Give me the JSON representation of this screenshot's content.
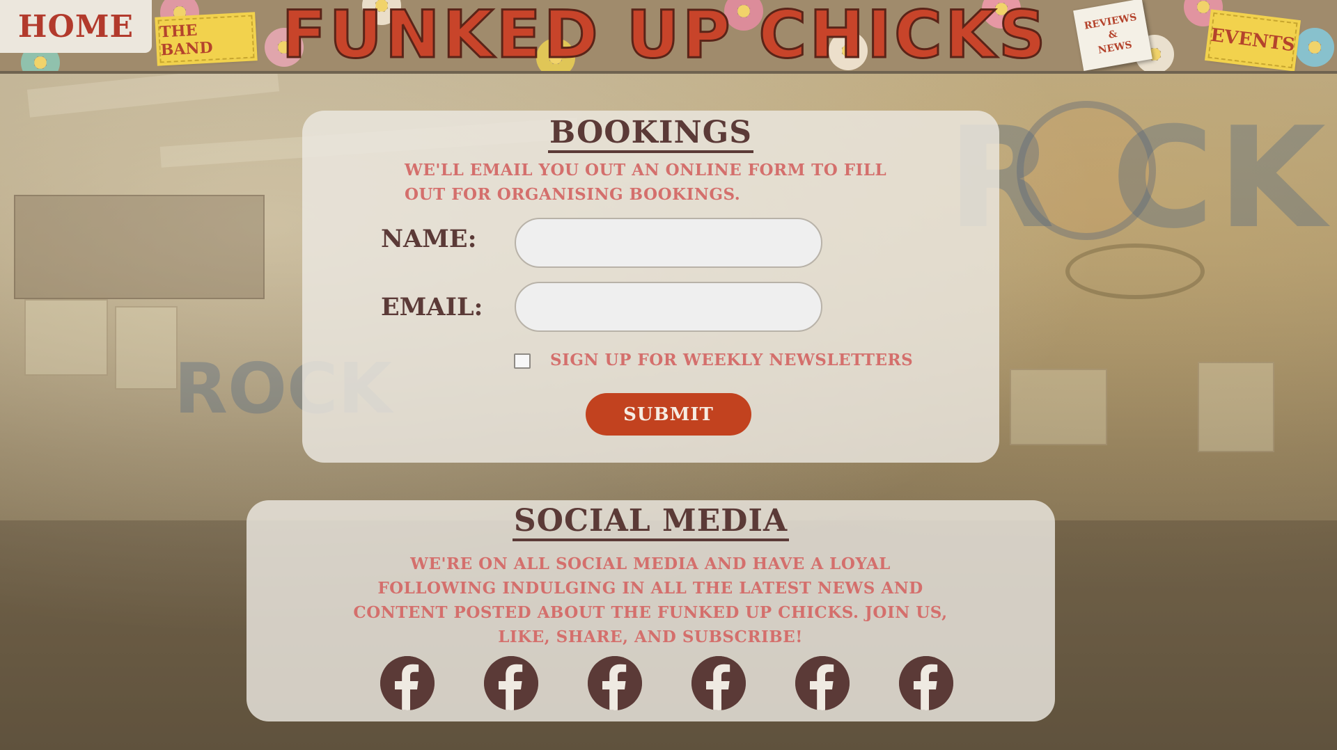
{
  "header": {
    "home_label": "Home",
    "band_label": "The Band",
    "site_title": "Funked Up Chicks",
    "news_label": [
      "Reviews",
      "&",
      "News"
    ],
    "events_label": "Events"
  },
  "bookings": {
    "title": "Bookings",
    "blurb": "We'll email you out an online form to fill out for organising bookings.",
    "name_label": "Name:",
    "email_label": "Email:",
    "name_value": "",
    "email_value": "",
    "newsletter_label": "Sign up for weekly newsletters",
    "newsletter_checked": false,
    "submit_label": "Submit"
  },
  "social": {
    "title": "Social Media",
    "blurb": "We're on all social media and have a loyal following indulging in all the latest news and content posted about the Funked Up Chicks. Join us, like, share, and subscribe!",
    "icons": [
      "facebook-icon",
      "facebook-icon",
      "facebook-icon",
      "facebook-icon",
      "facebook-icon",
      "facebook-icon"
    ]
  },
  "colors": {
    "accent": "#c2421f",
    "heading": "#5b3a37",
    "blurb": "#d46f6c",
    "ticket": "#f2d24d"
  }
}
